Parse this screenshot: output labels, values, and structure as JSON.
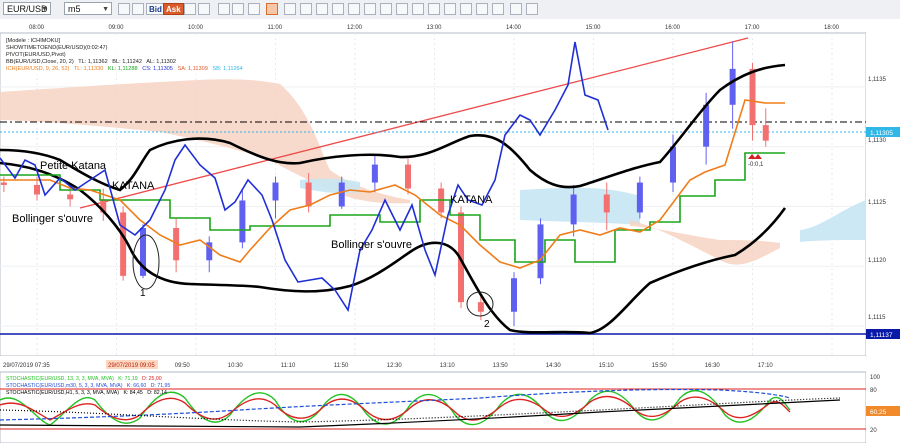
{
  "toolbar": {
    "symbol": "EUR/USD",
    "timeframe": "m5",
    "bid_label": "Bid",
    "ask_label": "Ask"
  },
  "indicators": {
    "line1": "[Modele : ICHIMOKU]",
    "line2": "SHOWTIMETOEND(EUR/USD)(0:02:47)",
    "line3": "PIVOT(EUR/USD,Pivot)",
    "line4_prefix": "BB(EUR/USD,Close, 20, 2)",
    "line4_tl": "TL: 1,11362",
    "line4_bl": "BL: 1,11242",
    "line4_al": "AL: 1,11302",
    "line5_prefix": "ICH(EUR/USD, 9, 26, 52)",
    "line5_tl": "TL: 1,11330",
    "line5_kl": "KL: 1,11288",
    "line5_cs": "CS: 1,11305",
    "line5_sa": "SA: 1,11309",
    "line5_sb": "SB: 1,11264"
  },
  "colors": {
    "candle_up": "#6060f0",
    "candle_down": "#f27070",
    "tenkan": "#f07d1a",
    "kijun": "#1aa51a",
    "chikou": "#1f2fd6",
    "bollinger": "#000000",
    "cloud_bear": "#f4c9b5",
    "cloud_bull": "#bfe3f2",
    "trendline": "#ee4a4a",
    "pivot": "#000000",
    "support": "#0a1aa8",
    "cyan_line": "#2fb7e8",
    "stoch_green": "#22c222",
    "stoch_red": "#dd2222",
    "stoch_blue": "#1f4fd6"
  },
  "annotations": {
    "petite_katana": "Petite Katana",
    "katana1": "KATANA",
    "katana2": "KATANA",
    "bollinger1": "Bollinger s'ouvre",
    "bollinger2": "Bollinger s'ouvre",
    "mark1": "1",
    "mark2": "2",
    "signal_label": "-0:0,1"
  },
  "stoch": {
    "line1": "STOCHASTIC(EUR/USD, 13, 3, 3, MVA, MVA)",
    "line1_k": "K: 71,19",
    "line1_d": "D: 25,00",
    "line2": "STOCHASTIC(EUR/USD,m30, 5, 3, 3, MVA, MVA)",
    "line2_k": "K: 66,60",
    "line2_d": "D: 71,95",
    "line3": "STOCHASTIC(EUR/USD,H1, 5, 3, 3, MVA, MVA)",
    "line3_k": "K: 84,45",
    "line3_d": "D: 82,14",
    "levels": [
      "100",
      "80",
      "20"
    ],
    "value_label": "60,25"
  },
  "time_axis": {
    "top_labels": [
      "08:00",
      "09:00",
      "10:00",
      "11:00",
      "12:00",
      "13:00",
      "14:00",
      "15:00",
      "16:00",
      "17:00",
      "18:00"
    ],
    "bottom_labels": [
      "09:50",
      "10:30",
      "11:10",
      "11:50",
      "12:30",
      "13:10",
      "13:50",
      "14:30",
      "15:10",
      "15:50",
      "16:30",
      "17:10"
    ],
    "start_label": "29/07/2019 07:35",
    "highlight_label": "29/07/2019 09:05"
  },
  "price_axis": {
    "labels": [
      "1,1135",
      "1,1130",
      "1,1125",
      "1,1120",
      "1,1115"
    ],
    "current_price": "1,11305",
    "support_price": "1,11137"
  },
  "chart_data": {
    "type": "candlestick",
    "symbol": "EUR/USD",
    "timeframe": "m5",
    "ylim": [
      1.11125,
      1.11395
    ],
    "x_range": [
      "07:35",
      "17:15"
    ],
    "candles": [
      {
        "t": "07:35",
        "o": 1.1127,
        "h": 1.11275,
        "l": 1.11262,
        "c": 1.11268
      },
      {
        "t": "08:00",
        "o": 1.11268,
        "h": 1.11275,
        "l": 1.11255,
        "c": 1.1126
      },
      {
        "t": "08:25",
        "o": 1.1126,
        "h": 1.11268,
        "l": 1.1125,
        "c": 1.11256
      },
      {
        "t": "08:50",
        "o": 1.11256,
        "h": 1.11265,
        "l": 1.11238,
        "c": 1.11245
      },
      {
        "t": "09:05",
        "o": 1.11245,
        "h": 1.1125,
        "l": 1.11188,
        "c": 1.11192
      },
      {
        "t": "09:20",
        "o": 1.11192,
        "h": 1.11235,
        "l": 1.1119,
        "c": 1.11232
      },
      {
        "t": "09:45",
        "o": 1.11232,
        "h": 1.1124,
        "l": 1.11195,
        "c": 1.11205
      },
      {
        "t": "10:10",
        "o": 1.11205,
        "h": 1.11225,
        "l": 1.11195,
        "c": 1.1122
      },
      {
        "t": "10:35",
        "o": 1.1122,
        "h": 1.11265,
        "l": 1.11215,
        "c": 1.11255
      },
      {
        "t": "11:00",
        "o": 1.11255,
        "h": 1.11275,
        "l": 1.1124,
        "c": 1.1127
      },
      {
        "t": "11:25",
        "o": 1.1127,
        "h": 1.11278,
        "l": 1.11245,
        "c": 1.1125
      },
      {
        "t": "11:50",
        "o": 1.1125,
        "h": 1.11275,
        "l": 1.11248,
        "c": 1.1127
      },
      {
        "t": "12:15",
        "o": 1.1127,
        "h": 1.11292,
        "l": 1.11262,
        "c": 1.11285
      },
      {
        "t": "12:40",
        "o": 1.11285,
        "h": 1.1129,
        "l": 1.1126,
        "c": 1.11265
      },
      {
        "t": "13:05",
        "o": 1.11265,
        "h": 1.1127,
        "l": 1.1124,
        "c": 1.11245
      },
      {
        "t": "13:20",
        "o": 1.11245,
        "h": 1.1125,
        "l": 1.11165,
        "c": 1.1117
      },
      {
        "t": "13:35",
        "o": 1.1117,
        "h": 1.11175,
        "l": 1.11155,
        "c": 1.11162
      },
      {
        "t": "14:00",
        "o": 1.11162,
        "h": 1.11195,
        "l": 1.1115,
        "c": 1.1119
      },
      {
        "t": "14:20",
        "o": 1.1119,
        "h": 1.1124,
        "l": 1.11185,
        "c": 1.11235
      },
      {
        "t": "14:45",
        "o": 1.11235,
        "h": 1.11268,
        "l": 1.11225,
        "c": 1.1126
      },
      {
        "t": "15:10",
        "o": 1.1126,
        "h": 1.1127,
        "l": 1.1123,
        "c": 1.11245
      },
      {
        "t": "15:35",
        "o": 1.11245,
        "h": 1.11275,
        "l": 1.1124,
        "c": 1.1127
      },
      {
        "t": "16:00",
        "o": 1.1127,
        "h": 1.1131,
        "l": 1.11262,
        "c": 1.113
      },
      {
        "t": "16:25",
        "o": 1.113,
        "h": 1.11345,
        "l": 1.11285,
        "c": 1.11335
      },
      {
        "t": "16:45",
        "o": 1.11335,
        "h": 1.11388,
        "l": 1.11315,
        "c": 1.11365
      },
      {
        "t": "17:00",
        "o": 1.11365,
        "h": 1.1137,
        "l": 1.11305,
        "c": 1.11318
      },
      {
        "t": "17:10",
        "o": 1.11318,
        "h": 1.11332,
        "l": 1.113,
        "c": 1.11305
      }
    ],
    "levels": {
      "pivot": 1.11318,
      "current": 1.11305,
      "support": 1.11137
    }
  }
}
